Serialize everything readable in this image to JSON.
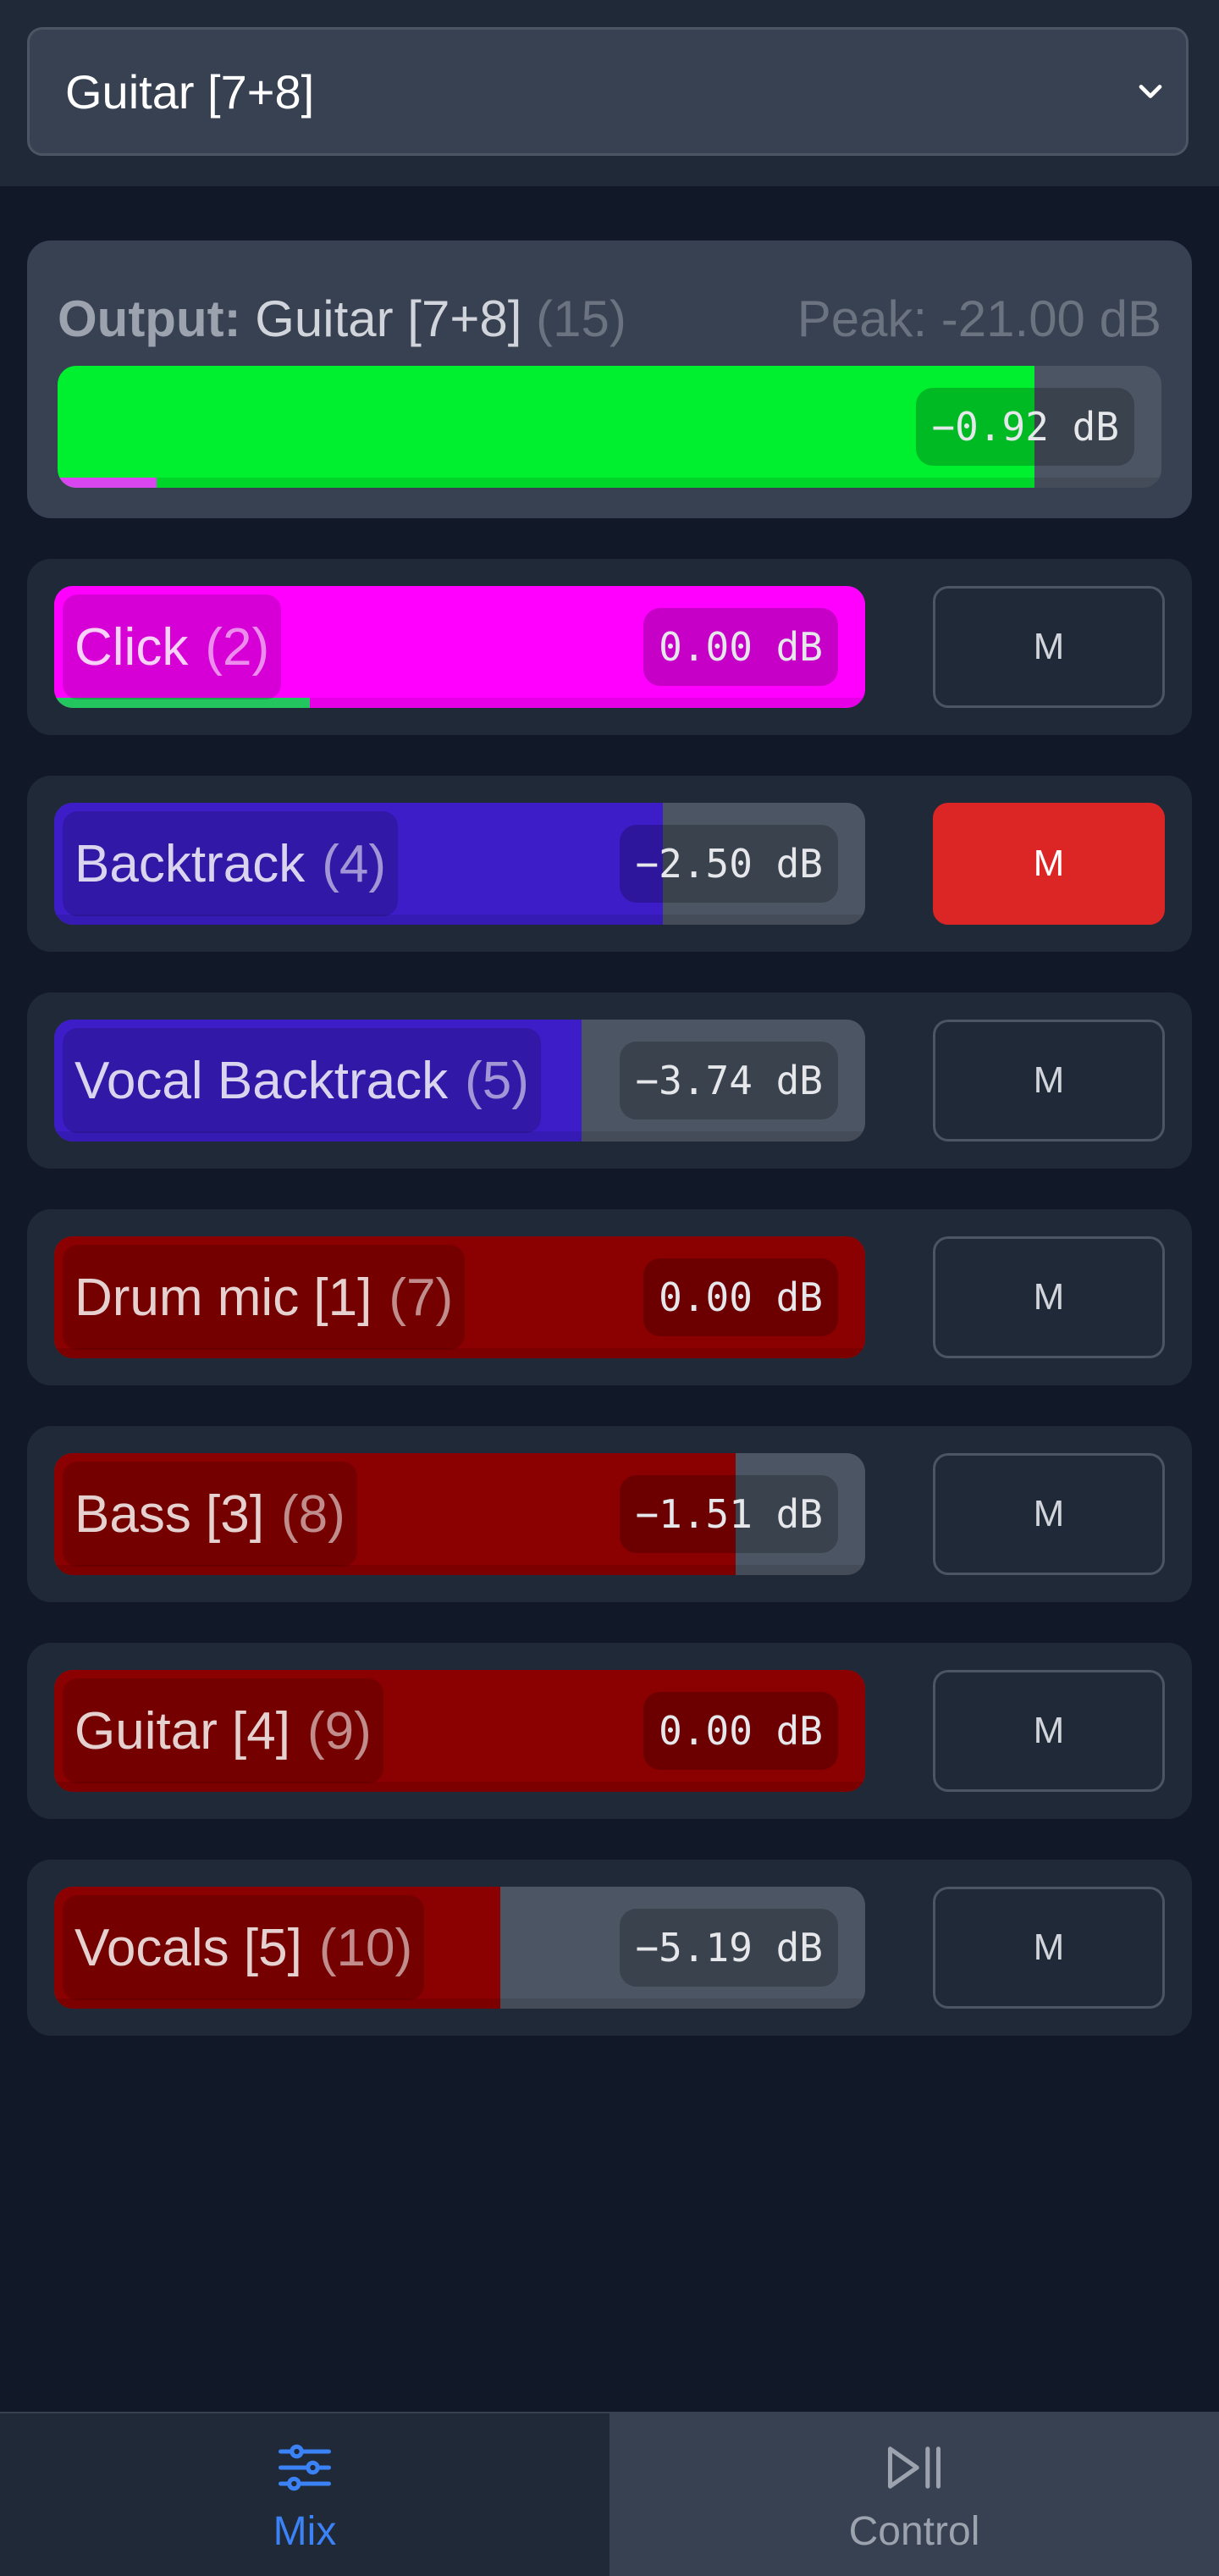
{
  "selector": {
    "value": "Guitar [7+8]"
  },
  "output": {
    "label": "Output:",
    "name": "Guitar [7+8]",
    "index": "(15)",
    "peak": "Peak: -21.00 dB",
    "db": "−0.92 dB",
    "fader_fraction": 0.885,
    "level_fraction": 0.09,
    "fader_color": "#00ef2f",
    "level_color": "#d946ef"
  },
  "channels": [
    {
      "name": "Click",
      "index": "(2)",
      "db": "0.00 dB",
      "fader_fraction": 1.0,
      "level_fraction": 0.315,
      "color": "#ff00ff",
      "level_color": "#22c55e",
      "mute_label": "M",
      "muted": false
    },
    {
      "name": "Backtrack",
      "index": "(4)",
      "db": "−2.50 dB",
      "fader_fraction": 0.75,
      "level_fraction": 0.0,
      "color": "#3c1dc8",
      "level_color": "#3c1dc8",
      "mute_label": "M",
      "muted": true
    },
    {
      "name": "Vocal Backtrack",
      "index": "(5)",
      "db": "−3.74 dB",
      "fader_fraction": 0.65,
      "level_fraction": 0.0,
      "color": "#3c1dc8",
      "level_color": "#3c1dc8",
      "mute_label": "M",
      "muted": false
    },
    {
      "name": "Drum mic [1]",
      "index": "(7)",
      "db": "0.00 dB",
      "fader_fraction": 1.0,
      "level_fraction": 0.0,
      "color": "#8b0000",
      "level_color": "#8b0000",
      "mute_label": "M",
      "muted": false
    },
    {
      "name": "Bass [3]",
      "index": "(8)",
      "db": "−1.51 dB",
      "fader_fraction": 0.84,
      "level_fraction": 0.0,
      "color": "#8b0000",
      "level_color": "#8b0000",
      "mute_label": "M",
      "muted": false
    },
    {
      "name": "Guitar [4]",
      "index": "(9)",
      "db": "0.00 dB",
      "fader_fraction": 1.0,
      "level_fraction": 0.0,
      "color": "#8b0000",
      "level_color": "#8b0000",
      "mute_label": "M",
      "muted": false
    },
    {
      "name": "Vocals [5]",
      "index": "(10)",
      "db": "−5.19 dB",
      "fader_fraction": 0.55,
      "level_fraction": 0.0,
      "color": "#8b0000",
      "level_color": "#8b0000",
      "mute_label": "M",
      "muted": false
    }
  ],
  "tabs": [
    {
      "label": "Mix",
      "icon": "sliders-icon",
      "active": true
    },
    {
      "label": "Control",
      "icon": "play-pause-icon",
      "active": false
    }
  ]
}
